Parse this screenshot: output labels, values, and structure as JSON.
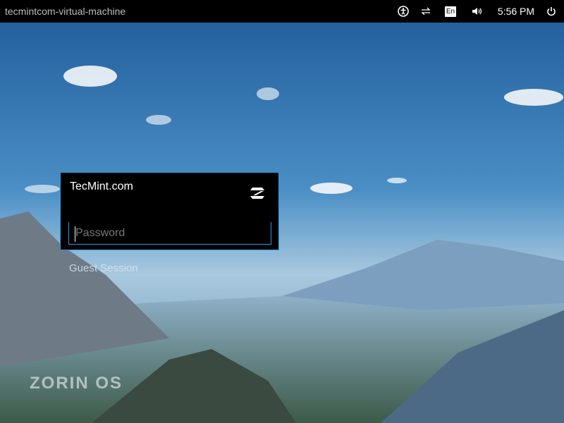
{
  "topbar": {
    "hostname": "tecmintcom-virtual-machine",
    "keyboard_layout": "En",
    "time": "5:56 PM",
    "icons": [
      "accessibility-icon",
      "network-icon",
      "keyboard-layout-icon",
      "volume-icon",
      "power-icon"
    ]
  },
  "login": {
    "username": "TecMint.com",
    "password_placeholder": "Password",
    "guest_session": "Guest Session",
    "accent": "#2b9be0"
  },
  "branding": {
    "logo_text": "ZORIN OS"
  }
}
